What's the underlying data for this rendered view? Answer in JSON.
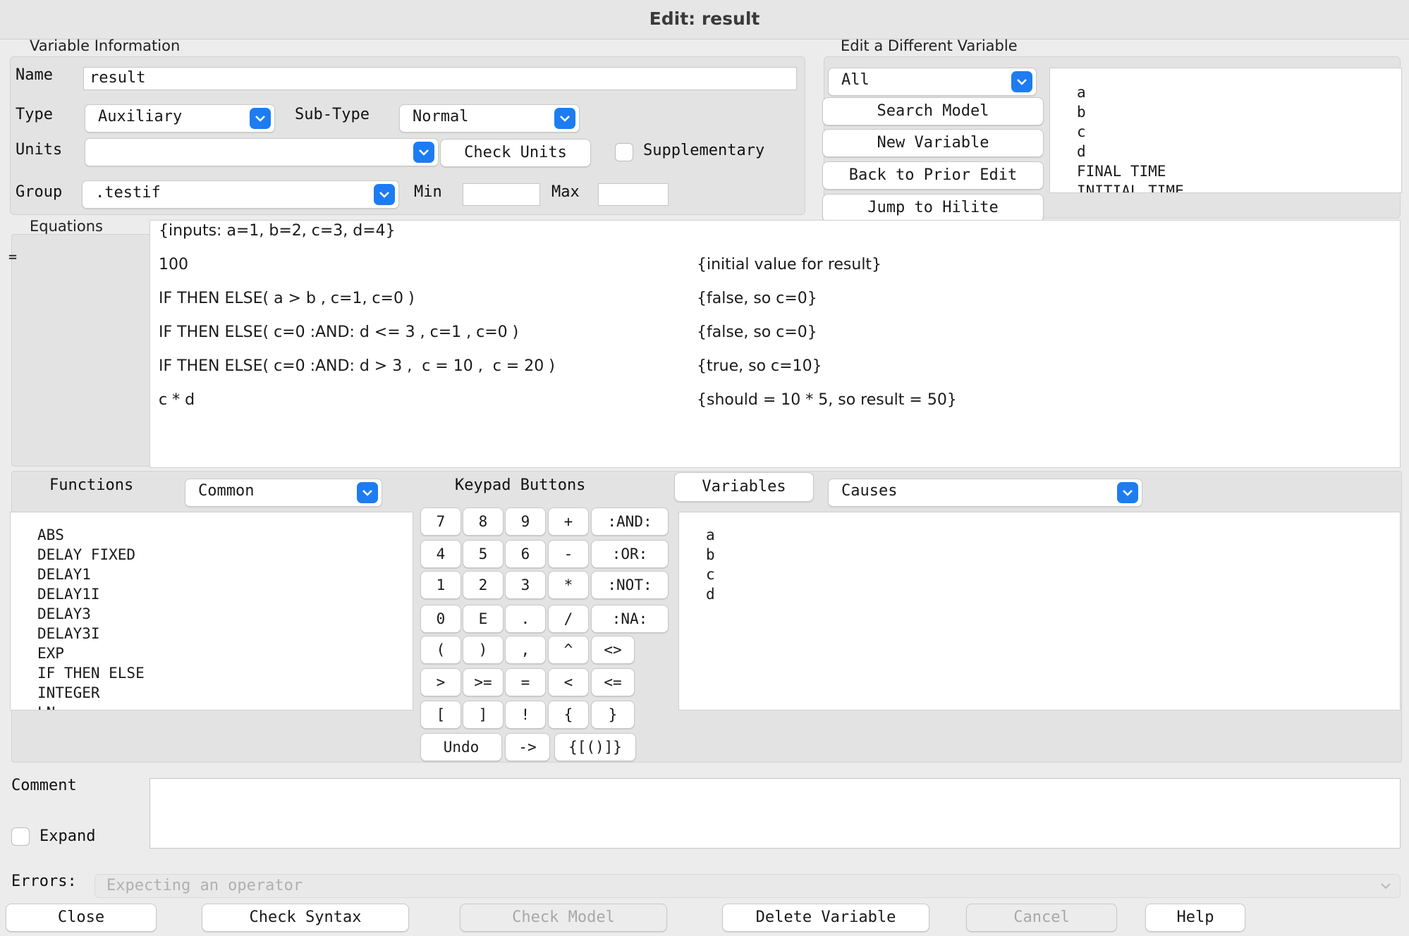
{
  "window": {
    "title": "Edit: result"
  },
  "variable_info": {
    "section_title": "Variable Information",
    "name_label": "Name",
    "name_value": "result",
    "type_label": "Type",
    "type_value": "Auxiliary",
    "subtype_label": "Sub-Type",
    "subtype_value": "Normal",
    "units_label": "Units",
    "units_value": "",
    "check_units_label": "Check Units",
    "supplementary_label": "Supplementary",
    "group_label": "Group",
    "group_value": ".testif",
    "min_label": "Min",
    "min_value": "",
    "max_label": "Max",
    "max_value": ""
  },
  "edit_different": {
    "section_title": "Edit a Different Variable",
    "filter_value": "All",
    "search_model_label": "Search Model",
    "new_variable_label": "New Variable",
    "back_to_prior_label": "Back to Prior Edit",
    "jump_to_hilite_label": "Jump to Hilite",
    "variable_list": [
      "a",
      "b",
      "c",
      "d",
      "FINAL TIME",
      "INITIAL TIME"
    ]
  },
  "equations": {
    "section_title": "Equations",
    "equals_sign": "=",
    "lines": [
      {
        "code": "{inputs: a=1, b=2, c=3, d=4}",
        "comment": ""
      },
      {
        "code": "100",
        "comment": "{initial value for result}"
      },
      {
        "code": "IF THEN ELSE( a > b , c=1, c=0 )",
        "comment": "{false, so c=0}"
      },
      {
        "code": "IF THEN ELSE( c=0 :AND: d <= 3 , c=1 , c=0 )",
        "comment": "{false, so c=0}"
      },
      {
        "code": "IF THEN ELSE( c=0 :AND: d > 3 ,  c = 10 ,  c = 20 )",
        "comment": "{true, so c=10}"
      },
      {
        "code": "c * d",
        "comment": "{should = 10 * 5, so result = 50}"
      }
    ]
  },
  "functions": {
    "label": "Functions",
    "category_value": "Common",
    "items": [
      "ABS",
      "DELAY FIXED",
      "DELAY1",
      "DELAY1I",
      "DELAY3",
      "DELAY3I",
      "EXP",
      "IF THEN ELSE",
      "INTEGER",
      "LN"
    ]
  },
  "keypad": {
    "label": "Keypad Buttons",
    "rows": [
      [
        "7",
        "8",
        "9",
        "+",
        ":AND:"
      ],
      [
        "4",
        "5",
        "6",
        "-",
        ":OR:"
      ],
      [
        "1",
        "2",
        "3",
        "*",
        ":NOT:"
      ],
      [
        "0",
        "E",
        ".",
        "/",
        ":NA:"
      ],
      [
        "(",
        ")",
        ",",
        "^",
        "<>"
      ],
      [
        ">",
        ">=",
        "=",
        "<",
        "<="
      ],
      [
        "[",
        "]",
        "!",
        "{",
        "}"
      ],
      [
        "Undo",
        "->",
        "{[()]}"
      ]
    ]
  },
  "variables": {
    "button_label": "Variables",
    "mode_value": "Causes",
    "items": [
      "a",
      "b",
      "c",
      "d"
    ]
  },
  "comment": {
    "label": "Comment",
    "value": "",
    "expand_label": "Expand"
  },
  "errors": {
    "label": "Errors:",
    "value": "Expecting an operator"
  },
  "footer": {
    "close_label": "Close",
    "check_syntax_label": "Check Syntax",
    "check_model_label": "Check Model",
    "delete_variable_label": "Delete Variable",
    "cancel_label": "Cancel",
    "help_label": "Help"
  },
  "colors": {
    "accent": "#1d7cf2",
    "background": "#ececec",
    "panel": "#e3e3e3",
    "disabled_text": "#a8a8a8"
  }
}
